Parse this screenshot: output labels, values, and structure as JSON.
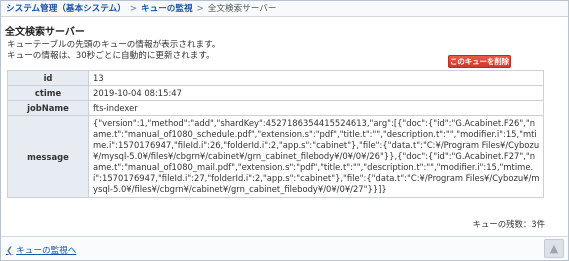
{
  "breadcrumb": {
    "root": "システム管理（基本システム）",
    "parent": "キューの監視",
    "current": "全文検索サーバー"
  },
  "page_title": "全文検索サーバー",
  "description": {
    "line1": "キューテーブルの先頭のキューの情報が表示されます。",
    "line2": "キューの情報は、30秒ごとに自動的に更新されます。"
  },
  "delete_button": "このキューを削除",
  "detail": {
    "id_label": "id",
    "id_value": "13",
    "ctime_label": "ctime",
    "ctime_value": "2019-10-04 08:15:47",
    "jobname_label": "jobName",
    "jobname_value": "fts-indexer",
    "message_label": "message",
    "message_value": "{\"version\":1,\"method\":\"add\",\"shardKey\":4527186354415524613,\"arg\":[{\"doc\":{\"id\":\"G.Acabinet.F26\",\"name.t\":\"manual_of1080_schedule.pdf\",\"extension.s\":\"pdf\",\"title.t\":\"\",\"description.t\":\"\",\"modifier.i\":15,\"mtime.i\":1570176947,\"fileId.i\":26,\"folderId.i\":2,\"app.s\":\"cabinet\"},\"file\":{\"data.t\":\"C:¥/Program Files¥/Cybozu¥/mysql-5.0¥/files¥/cbgrn¥/cabinet¥/grn_cabinet_filebody¥/0¥/0¥/26\"}},{\"doc\":{\"id\":\"G.Acabinet.F27\",\"name.t\":\"manual_of1080_mail.pdf\",\"extension.s\":\"pdf\",\"title.t\":\"\",\"description.t\":\"\",\"modifier.i\":15,\"mtime.i\":1570176947,\"fileId.i\":27,\"folderId.i\":2,\"app.s\":\"cabinet\"},\"file\":{\"data.t\":\"C:¥/Program Files¥/Cybozu¥/mysql-5.0¥/files¥/cbgrn¥/cabinet¥/grn_cabinet_filebody¥/0¥/0¥/27\"}}]}"
  },
  "queue_count": "キューの残数：3件",
  "back_link": "キューの監視へ",
  "icons": {
    "back": "chevron-left-icon",
    "scroll_top": "chevron-up-icon"
  },
  "colors": {
    "link": "#1a55a8",
    "delete_button": "#cc3a28",
    "header_cell": "#e6ecf2"
  }
}
